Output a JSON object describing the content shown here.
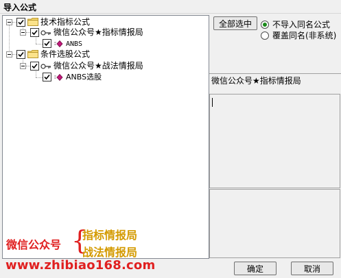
{
  "window": {
    "title": "导入公式"
  },
  "tree": {
    "nodes": [
      {
        "label": "技术指标公式",
        "type": "folder",
        "checked": true
      },
      {
        "label": "微信公众号★指标情报局",
        "type": "key",
        "checked": true
      },
      {
        "label": "ANBS",
        "type": "formula",
        "checked": true
      },
      {
        "label": "条件选股公式",
        "type": "folder",
        "checked": true
      },
      {
        "label": "微信公众号★战法情报局",
        "type": "key",
        "checked": true
      },
      {
        "label": "ANBS选股",
        "type": "formula",
        "checked": true
      }
    ]
  },
  "watermark": {
    "left": "微信公众号",
    "brace": "{",
    "right_top": "指标情报局",
    "right_bottom": "战法情报局",
    "url": "www.zhibiao168.com"
  },
  "options": {
    "select_all_label": "全部选中",
    "radio_1": "不导入同名公式",
    "radio_2": "覆盖同名(非系统)",
    "selected_radio": 1
  },
  "detail": {
    "name": "微信公众号★指标情报局",
    "text": ""
  },
  "footer": {
    "ok_label": "确定",
    "cancel_label": "取消"
  },
  "colors": {
    "watermark_red": "#e02020",
    "watermark_gold": "#d49a00",
    "radio_dot": "#1a8a1a"
  }
}
